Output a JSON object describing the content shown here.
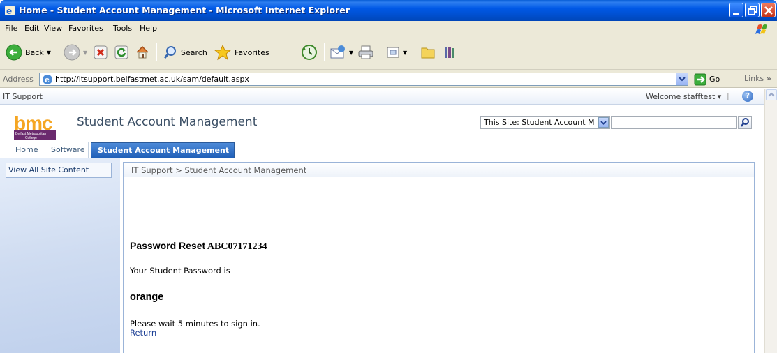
{
  "window": {
    "title": "Home - Student Account Management - Microsoft Internet Explorer"
  },
  "menu": [
    "File",
    "Edit",
    "View",
    "Favorites",
    "Tools",
    "Help"
  ],
  "toolbar": {
    "back_label": "Back",
    "search_label": "Search",
    "favorites_label": "Favorites"
  },
  "address": {
    "label": "Address",
    "url": "http://itsupport.belfastmet.ac.uk/sam/default.aspx",
    "go_label": "Go",
    "links_label": "Links"
  },
  "sharepoint": {
    "site_parent": "IT Support",
    "welcome": "Welcome stafftest ▾",
    "logo_text": "bmc",
    "logo_sub": "Belfast Metropolitan College",
    "site_title": "Student Account Management",
    "search_scope": "This Site: Student Account Mai",
    "search_value": "",
    "tabs": [
      {
        "label": "Home"
      },
      {
        "label": "Software"
      },
      {
        "label": "Student Account Management"
      }
    ],
    "quicklaunch_label": "View All Site Content",
    "breadcrumb": "IT Support > Student Account Management"
  },
  "result": {
    "title_prefix": "Password Reset",
    "student_id": "ABC07171234",
    "label": "Your Student Password is",
    "password": "orange",
    "wait_text": "Please wait 5 minutes to sign in.",
    "return_link": "Return"
  },
  "colors": {
    "xp_title_blue": "#0058e6",
    "selected_tab": "#1f5fb8",
    "logo_orange": "#f5a623",
    "logo_purple": "#6b2a6e"
  }
}
